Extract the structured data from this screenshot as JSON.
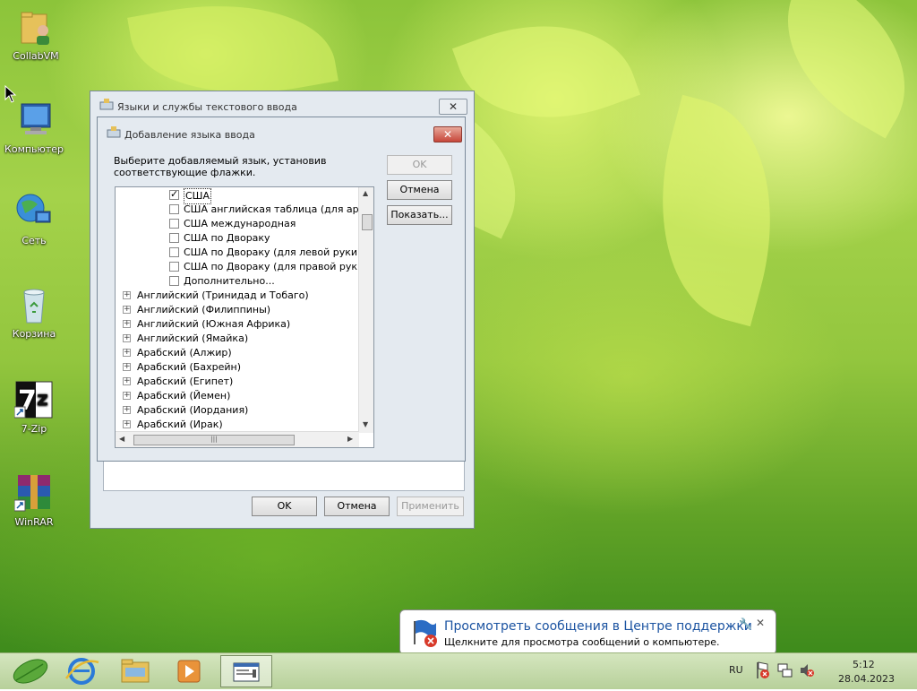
{
  "desktop": {
    "icons": [
      {
        "label": "CollabVM"
      },
      {
        "label": "Компьютер"
      },
      {
        "label": "Сеть"
      },
      {
        "label": "Корзина"
      },
      {
        "label": "7-Zip"
      },
      {
        "label": "WinRAR"
      }
    ]
  },
  "outer_dialog": {
    "title": "Языки и службы текстового ввода",
    "close": "✕",
    "ok": "OK",
    "cancel": "Отмена",
    "apply": "Применить"
  },
  "inner_dialog": {
    "title": "Добавление языка ввода",
    "close": "✕",
    "instructions": "Выберите добавляемый язык, установив соответствующие флажки.",
    "ok": "OK",
    "cancel": "Отмена",
    "show": "Показать...",
    "checkbox_items": [
      {
        "label": "США",
        "checked": true
      },
      {
        "label": "США английская таблица (для арабск",
        "checked": false
      },
      {
        "label": "США международная",
        "checked": false
      },
      {
        "label": "США по Двораку",
        "checked": false
      },
      {
        "label": "США по Двораку (для левой руки)",
        "checked": false
      },
      {
        "label": "США по Двораку (для правой руки)",
        "checked": false
      },
      {
        "label": "Дополнительно...",
        "checked": false
      }
    ],
    "language_items": [
      "Английский (Тринидад и Тобаго)",
      "Английский (Филиппины)",
      "Английский (Южная Африка)",
      "Английский (Ямайка)",
      "Арабский (Алжир)",
      "Арабский (Бахрейн)",
      "Арабский (Египет)",
      "Арабский (Йемен)",
      "Арабский (Иордания)",
      "Арабский (Ирак)"
    ]
  },
  "notification": {
    "title": "Просмотреть сообщения в Центре поддержки",
    "text": "Щелкните для просмотра сообщений о компьютере.",
    "close": "✕"
  },
  "taskbar": {
    "language": "RU",
    "time": "5:12",
    "date": "28.04.2023"
  }
}
